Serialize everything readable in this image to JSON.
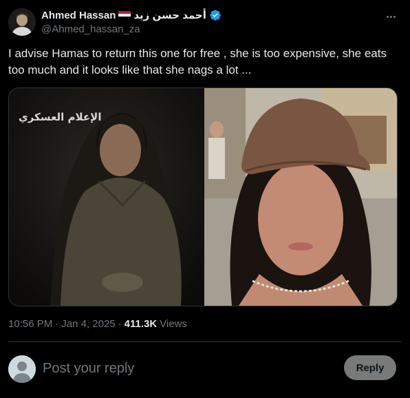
{
  "author": {
    "display_name": "Ahmed Hassan",
    "arabic_name": "أحمد حسن زيد",
    "handle": "@Ahmed_hassan_za",
    "flag": "egypt-flag",
    "verified": true
  },
  "tweet": {
    "text": "I advise Hamas to return this one for free , she is too expensive,  she eats too much and it looks like that she nags a lot ...",
    "time": "10:56 PM",
    "separator": "·",
    "date": "Jan 4, 2025",
    "views_count": "411.3K",
    "views_label": "Views"
  },
  "media": {
    "left_watermark": "الإعلام العسكري",
    "left_icon": "photo",
    "right_icon": "photo"
  },
  "reply": {
    "placeholder": "Post your reply",
    "button_label": "Reply"
  },
  "colors": {
    "background": "#000000",
    "text": "#e7e9ea",
    "muted": "#71767b",
    "verified": "#1d9bf0",
    "border": "#2f3336"
  }
}
